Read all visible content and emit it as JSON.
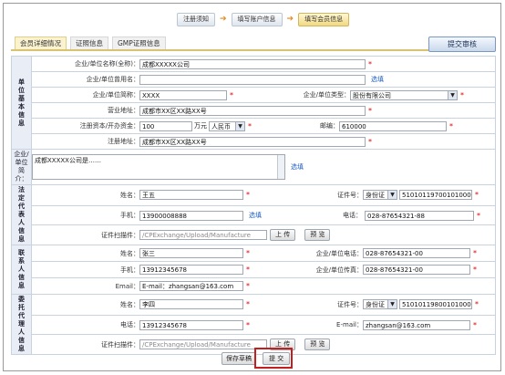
{
  "steps": [
    "注册须知",
    "填写账户信息",
    "填写会员信息"
  ],
  "tabs": [
    "会员详细情况",
    "证照信息",
    "GMP证照信息"
  ],
  "submit_review": "提交审核",
  "sections": {
    "basic": "单位基本信息",
    "intro": "企业/单位简介：",
    "legal": "法定代表人信息",
    "contact": "联系人信息",
    "agent": "委托代理人信息"
  },
  "basic": {
    "name_label": "企业/单位名称(全称)：",
    "name_value": "成都XXXXX公司",
    "alias_label": "企业/单位曾用名：",
    "alias_value": "",
    "alias_link": "选填",
    "short_label": "企业/单位简称：",
    "short_value": "XXXX",
    "type_label": "企业/单位类型：",
    "type_value": "股份有限公司",
    "biz_addr_label": "营业地址：",
    "biz_addr_value": "成都市XX区XX路XX号",
    "capital_label": "注册资本/开办资金：",
    "capital_value": "100",
    "capital_unit": "万元",
    "currency": "人民币",
    "zip_label": "邮编：",
    "zip_value": "610000",
    "reg_addr_label": "注册地址：",
    "reg_addr_value": "成都市XX区XX路XX号"
  },
  "intro": {
    "value": "成都XXXXX公司是……",
    "link": "选填"
  },
  "legal": {
    "name_label": "姓名：",
    "name_value": "王五",
    "id_label": "证件号：",
    "id_type": "身份证",
    "id_value": "510101197001010001",
    "phone_label": "手机：",
    "phone_value": "13900008888",
    "phone_link": "选填",
    "tel_label": "电话：",
    "tel_value": "028-87654321-88",
    "scan_label": "证件扫描件：",
    "scan_value": "/CPExchange/Upload/Manufacture",
    "upload": "上 传",
    "preview": "预 览"
  },
  "contact": {
    "name_label": "姓名：",
    "name_value": "张三",
    "tel_label": "企业/单位电话：",
    "tel_value": "028-87654321-00",
    "phone_label": "手机：",
    "phone_value": "13912345678",
    "fax_label": "企业/单位传真：",
    "fax_value": "028-87654321-00",
    "email_label": "Email：",
    "email_value": "E-mail：zhangsan@163.com"
  },
  "agent": {
    "name_label": "姓名：",
    "name_value": "李四",
    "id_label": "证件号：",
    "id_type": "身份证",
    "id_value": "510101198001010001",
    "tel_label": "电话：",
    "tel_value": "13912345678",
    "email_label": "E-mail：",
    "email_value": "zhangsan@163.com",
    "scan_label": "证件扫描件：",
    "scan_value": "/CPExchange/Upload/Manufacture",
    "upload": "上 传",
    "preview": "预 览"
  },
  "actions": {
    "save": "保存草稿",
    "submit": "提 交"
  },
  "required_mark": "*"
}
